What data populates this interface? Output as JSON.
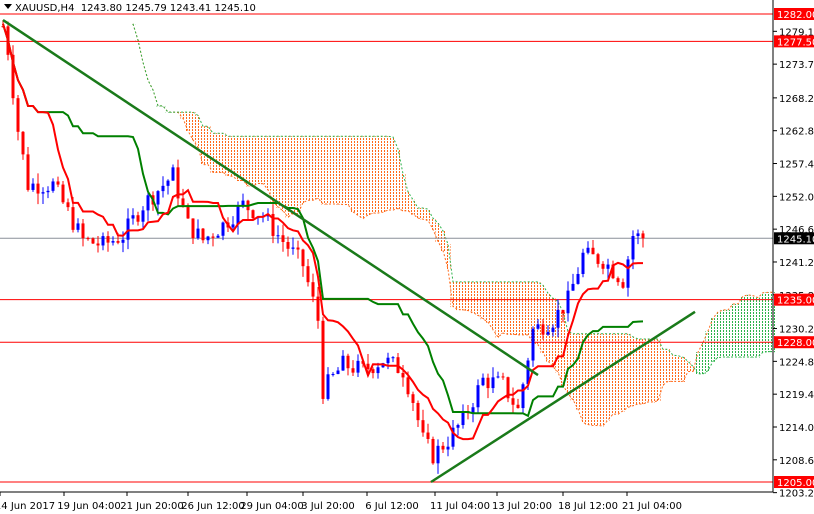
{
  "header": {
    "symbol": "XAUUSD,H4",
    "open": "1243.80",
    "high": "1245.79",
    "low": "1243.41",
    "close": "1245.10"
  },
  "chart_data": {
    "type": "candlestick",
    "title": "XAUUSD,H4",
    "ylim": [
      1203.25,
      1282.0
    ],
    "y_ticks": [
      "1279.15",
      "1273.75",
      "1268.20",
      "1262.80",
      "1257.40",
      "1252.00",
      "1246.60",
      "1241.20",
      "1235.80",
      "1230.25",
      "1224.85",
      "1219.45",
      "1214.05",
      "1208.65",
      "1203.25"
    ],
    "x_ticks": [
      "14 Jun 2017",
      "19 Jun 04:00",
      "21 Jun 20:00",
      "26 Jun 12:00",
      "29 Jun 04:00",
      "3 Jul 20:00",
      "6 Jul 12:00",
      "11 Jul 04:00",
      "13 Jul 20:00",
      "18 Jul 12:00",
      "21 Jul 04:00"
    ],
    "levels": [
      {
        "value": 1282.0,
        "label": "1282.00"
      },
      {
        "value": 1277.5,
        "label": "1277.50"
      },
      {
        "value": 1235.0,
        "label": "1235.00"
      },
      {
        "value": 1228.0,
        "label": "1228.00"
      },
      {
        "value": 1205.0,
        "label": "1205.00"
      }
    ],
    "current_price": {
      "value": 1245.1,
      "label": "1245.10"
    },
    "trendlines": [
      {
        "from": [
          0,
          1281.0
        ],
        "to": [
          107,
          1222.6
        ]
      },
      {
        "from": [
          85.6,
          1205.0
        ],
        "to": [
          138.4,
          1233.0
        ]
      }
    ],
    "price_knots": [
      [
        0,
        1280
      ],
      [
        1,
        1276.1
      ],
      [
        3,
        1262.9
      ],
      [
        5,
        1253.9
      ],
      [
        10,
        1253.9
      ],
      [
        16,
        1244.8
      ],
      [
        20,
        1244.0
      ],
      [
        24,
        1245.6
      ],
      [
        28,
        1250.6
      ],
      [
        34,
        1255.5
      ],
      [
        37,
        1247.3
      ],
      [
        40,
        1244.8
      ],
      [
        44,
        1247.3
      ],
      [
        48,
        1250.6
      ],
      [
        52,
        1248.9
      ],
      [
        55,
        1245.6
      ],
      [
        60,
        1240.7
      ],
      [
        63,
        1231.7
      ],
      [
        64,
        1220.1
      ],
      [
        68,
        1224.3
      ],
      [
        72,
        1223.4
      ],
      [
        76,
        1225.1
      ],
      [
        80,
        1223.4
      ],
      [
        82,
        1218.5
      ],
      [
        84,
        1211.9
      ],
      [
        86,
        1209.4
      ],
      [
        89,
        1211.9
      ],
      [
        92,
        1215.2
      ],
      [
        96,
        1221.8
      ],
      [
        100,
        1221.0
      ],
      [
        103,
        1216.8
      ],
      [
        106,
        1230.0
      ],
      [
        110,
        1231.7
      ],
      [
        113,
        1234.9
      ],
      [
        116,
        1242.3
      ],
      [
        120,
        1241.5
      ],
      [
        124,
        1238.2
      ],
      [
        126,
        1245.6
      ],
      [
        128,
        1245.1
      ]
    ],
    "colors": {
      "bull": "#0000ff",
      "bear": "#ff0000",
      "tenkan": "#ff0000",
      "kijun": "#008000",
      "cloud_bear": "#ff6a1a",
      "cloud_bull": "#2db34a",
      "level": "#ff0000",
      "trend": "#1a7a1a"
    }
  }
}
